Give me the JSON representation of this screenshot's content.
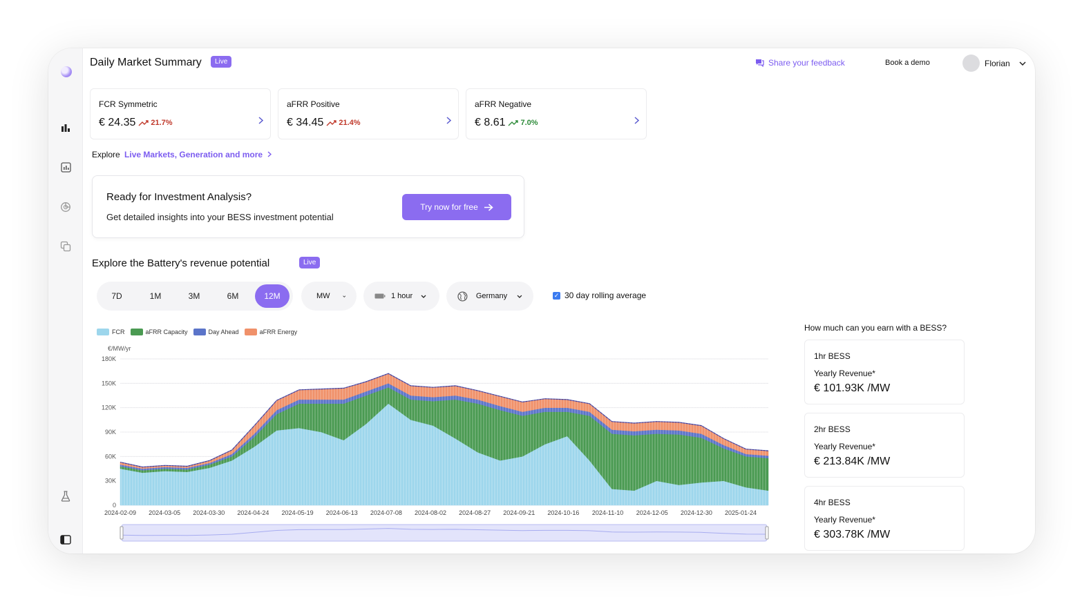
{
  "header": {
    "title": "Daily Market Summary",
    "live_badge": "Live",
    "feedback_label": "Share your feedback",
    "demo_label": "Book a demo",
    "user_name": "Florian"
  },
  "kpis": [
    {
      "name": "FCR Symmetric",
      "value": "€ 24.35",
      "change": "21.7%",
      "change_color": "#c0392b"
    },
    {
      "name": "aFRR Positive",
      "value": "€ 34.45",
      "change": "21.4%",
      "change_color": "#c0392b"
    },
    {
      "name": "aFRR Negative",
      "value": "€ 8.61",
      "change": "7.0%",
      "change_color": "#2e8b3a"
    }
  ],
  "explore": {
    "prefix": "Explore",
    "link": "Live Markets, Generation and more"
  },
  "invest": {
    "title": "Ready for Investment Analysis?",
    "subtitle": "Get detailed insights into your BESS investment potential",
    "button": "Try now for free"
  },
  "revenue": {
    "title": "Explore the Battery's revenue potential",
    "live_badge": "Live",
    "ranges": [
      "7D",
      "1M",
      "3M",
      "6M",
      "12M"
    ],
    "active_range": "12M",
    "unit_select": "MW",
    "duration_select": "1 hour",
    "country_select": "Germany",
    "rolling_label": "30 day rolling average",
    "rolling_checked": true
  },
  "chart_data": {
    "type": "area",
    "stacked": true,
    "ylabel": "€/MW/yr",
    "ylim": [
      0,
      180000
    ],
    "y_ticks": [
      "0",
      "30K",
      "60K",
      "90K",
      "120K",
      "150K",
      "180K"
    ],
    "x_ticks": [
      "2024-02-09",
      "2024-03-05",
      "2024-03-30",
      "2024-04-24",
      "2024-05-19",
      "2024-06-13",
      "2024-07-08",
      "2024-08-02",
      "2024-08-27",
      "2024-09-21",
      "2024-10-16",
      "2024-11-10",
      "2024-12-05",
      "2024-12-30",
      "2025-01-24"
    ],
    "x": [
      "2024-02-09",
      "2024-02-21",
      "2024-03-05",
      "2024-03-17",
      "2024-03-30",
      "2024-04-11",
      "2024-04-24",
      "2024-05-06",
      "2024-05-19",
      "2024-05-31",
      "2024-06-13",
      "2024-06-25",
      "2024-07-08",
      "2024-07-20",
      "2024-08-02",
      "2024-08-14",
      "2024-08-27",
      "2024-09-08",
      "2024-09-21",
      "2024-10-03",
      "2024-10-16",
      "2024-10-28",
      "2024-11-10",
      "2024-11-22",
      "2024-12-05",
      "2024-12-17",
      "2024-12-30",
      "2025-01-11",
      "2025-01-24",
      "2025-02-01"
    ],
    "series": [
      {
        "name": "FCR",
        "color": "#9dd6ec",
        "values": [
          45000,
          40000,
          42000,
          41000,
          46000,
          55000,
          72000,
          92000,
          95000,
          90000,
          80000,
          100000,
          125000,
          105000,
          98000,
          82000,
          65000,
          55000,
          60000,
          75000,
          85000,
          55000,
          20000,
          18000,
          30000,
          25000,
          28000,
          30000,
          22000,
          18000
        ]
      },
      {
        "name": "aFRR Capacity",
        "color": "#4a9a52",
        "values": [
          3000,
          3000,
          3000,
          3000,
          4000,
          5000,
          12000,
          20000,
          30000,
          35000,
          45000,
          35000,
          20000,
          25000,
          30000,
          48000,
          60000,
          62000,
          50000,
          40000,
          30000,
          55000,
          68000,
          68000,
          58000,
          62000,
          55000,
          40000,
          38000,
          40000
        ]
      },
      {
        "name": "Day Ahead",
        "color": "#5b74c9",
        "values": [
          2000,
          2000,
          2000,
          2000,
          2000,
          3000,
          4000,
          5000,
          5000,
          5000,
          5000,
          5000,
          5000,
          5000,
          5000,
          5000,
          5000,
          5000,
          5000,
          5000,
          5000,
          5000,
          5000,
          5000,
          5000,
          5000,
          5000,
          4000,
          3000,
          3000
        ]
      },
      {
        "name": "aFRR Energy",
        "color": "#f0916a",
        "values": [
          3000,
          2000,
          2000,
          2000,
          3000,
          5000,
          10000,
          12000,
          12000,
          13000,
          14000,
          12000,
          12000,
          12000,
          12000,
          12000,
          11000,
          12000,
          12000,
          11000,
          10000,
          10000,
          10000,
          10000,
          10000,
          10000,
          10000,
          8000,
          6000,
          6000
        ]
      }
    ]
  },
  "earn": {
    "title": "How much can you earn with a BESS?",
    "cards": [
      {
        "name": "1hr BESS",
        "label": "Yearly Revenue*",
        "value": "€ 101.93K /MW"
      },
      {
        "name": "2hr BESS",
        "label": "Yearly Revenue*",
        "value": "€ 213.84K /MW"
      },
      {
        "name": "4hr BESS",
        "label": "Yearly Revenue*",
        "value": "€ 303.78K /MW"
      }
    ]
  },
  "icons": {
    "logo": "brand-logo-icon",
    "nav": [
      "bar-chart-icon",
      "dashboard-icon",
      "pie-chart-icon",
      "layers-icon",
      "flask-icon",
      "sidebar-toggle-icon"
    ]
  }
}
